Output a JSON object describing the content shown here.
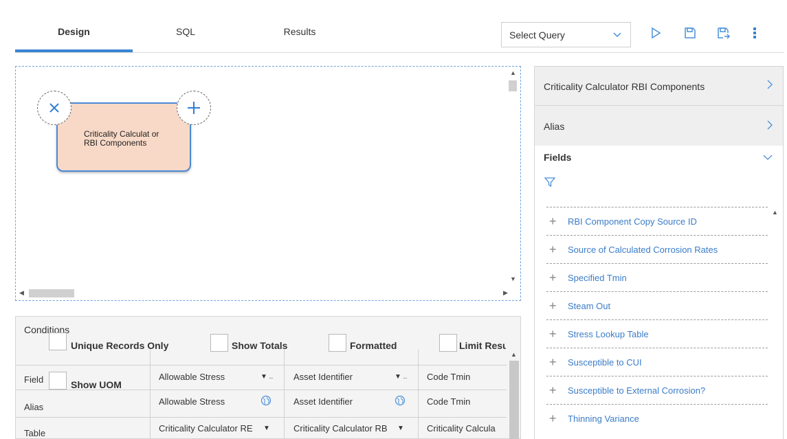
{
  "tabs": [
    {
      "label": "Design",
      "active": true
    },
    {
      "label": "SQL",
      "active": false
    },
    {
      "label": "Results",
      "active": false
    }
  ],
  "toolbar": {
    "select_query": "Select Query",
    "icons": [
      "play-icon",
      "save-icon",
      "save-as-icon",
      "more-vertical-icon"
    ]
  },
  "canvas": {
    "node_label": "Criticality Calculat or RBI Components"
  },
  "right_panel": {
    "family": "Criticality Calculator RBI Components",
    "alias": "Alias",
    "fields_title": "Fields",
    "fields": [
      "RBI Component Copy Source ID",
      "Source of Calculated Corrosion Rates",
      "Specified Tmin",
      "Steam Out",
      "Stress Lookup Table",
      "Susceptible to CUI",
      "Susceptible to External Corrosion?",
      "Thinning Variance"
    ]
  },
  "conditions": {
    "title": "Conditions",
    "options": [
      "Unique Records Only",
      "Show Totals",
      "Formatted",
      "Limit Results"
    ],
    "row_labels": {
      "field": "Field",
      "show_uom": "Show UOM",
      "alias": "Alias",
      "table": "Table"
    },
    "columns": [
      {
        "field": "Allowable Stress",
        "alias": "Allowable Stress",
        "table": "Criticality Calculator RE"
      },
      {
        "field": "Asset Identifier",
        "alias": "Asset Identifier",
        "table": "Criticality Calculator RB"
      },
      {
        "field": "Code Tmin",
        "alias": "Code Tmin",
        "table": "Criticality Calcula"
      }
    ]
  },
  "colors": {
    "accent": "#3a84d2",
    "link": "#3a7cc8",
    "node_fill": "#f8d9c7"
  }
}
